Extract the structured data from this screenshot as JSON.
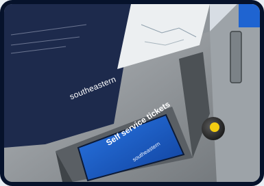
{
  "poster": {
    "brand": "southeastern"
  },
  "screen": {
    "title": "Self service tickets",
    "caption": "southeastern"
  },
  "colors": {
    "frame": "#06122b",
    "poster": "#1d2a4c",
    "screen_blue": "#1f62d0",
    "button_yellow": "#f3cc12"
  }
}
